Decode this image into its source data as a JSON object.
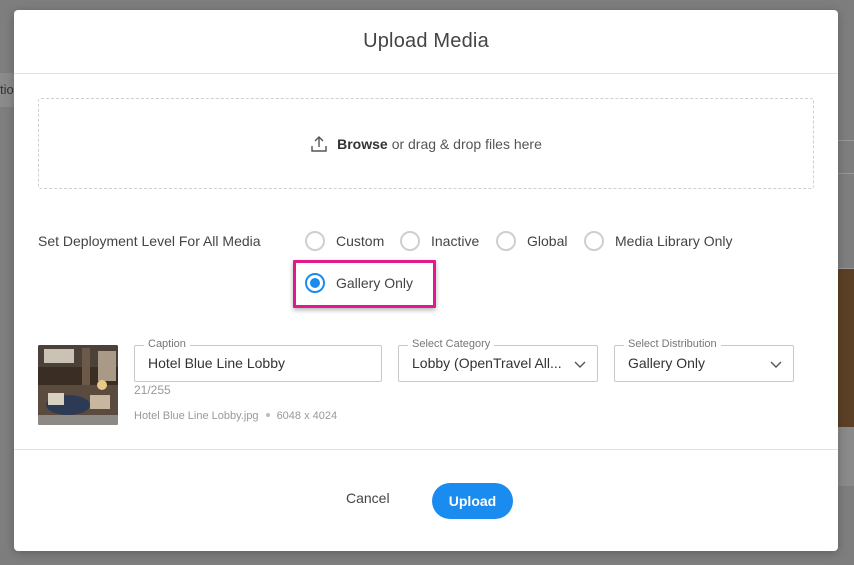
{
  "background": {
    "left_text": "tio"
  },
  "modal": {
    "title": "Upload Media"
  },
  "dropzone": {
    "icon": "upload-icon",
    "browse_label": "Browse",
    "hint": "or drag & drop files here"
  },
  "deployment": {
    "label": "Set Deployment Level For All Media",
    "options": [
      {
        "label": "Custom",
        "checked": false
      },
      {
        "label": "Inactive",
        "checked": false
      },
      {
        "label": "Global",
        "checked": false
      },
      {
        "label": "Media Library Only",
        "checked": false
      },
      {
        "label": "Gallery Only",
        "checked": true
      }
    ]
  },
  "media_item": {
    "caption_label": "Caption",
    "caption_value": "Hotel Blue Line Lobby",
    "caption_counter": "21/255",
    "category_label": "Select Category",
    "category_value": "Lobby (OpenTravel All...",
    "distribution_label": "Select Distribution",
    "distribution_value": "Gallery Only",
    "file_name": "Hotel Blue Line Lobby.jpg",
    "file_dimensions": "6048 x 4024"
  },
  "footer": {
    "cancel_label": "Cancel",
    "upload_label": "Upload"
  },
  "colors": {
    "accent": "#1a8cf0",
    "highlight": "#e0198c"
  }
}
